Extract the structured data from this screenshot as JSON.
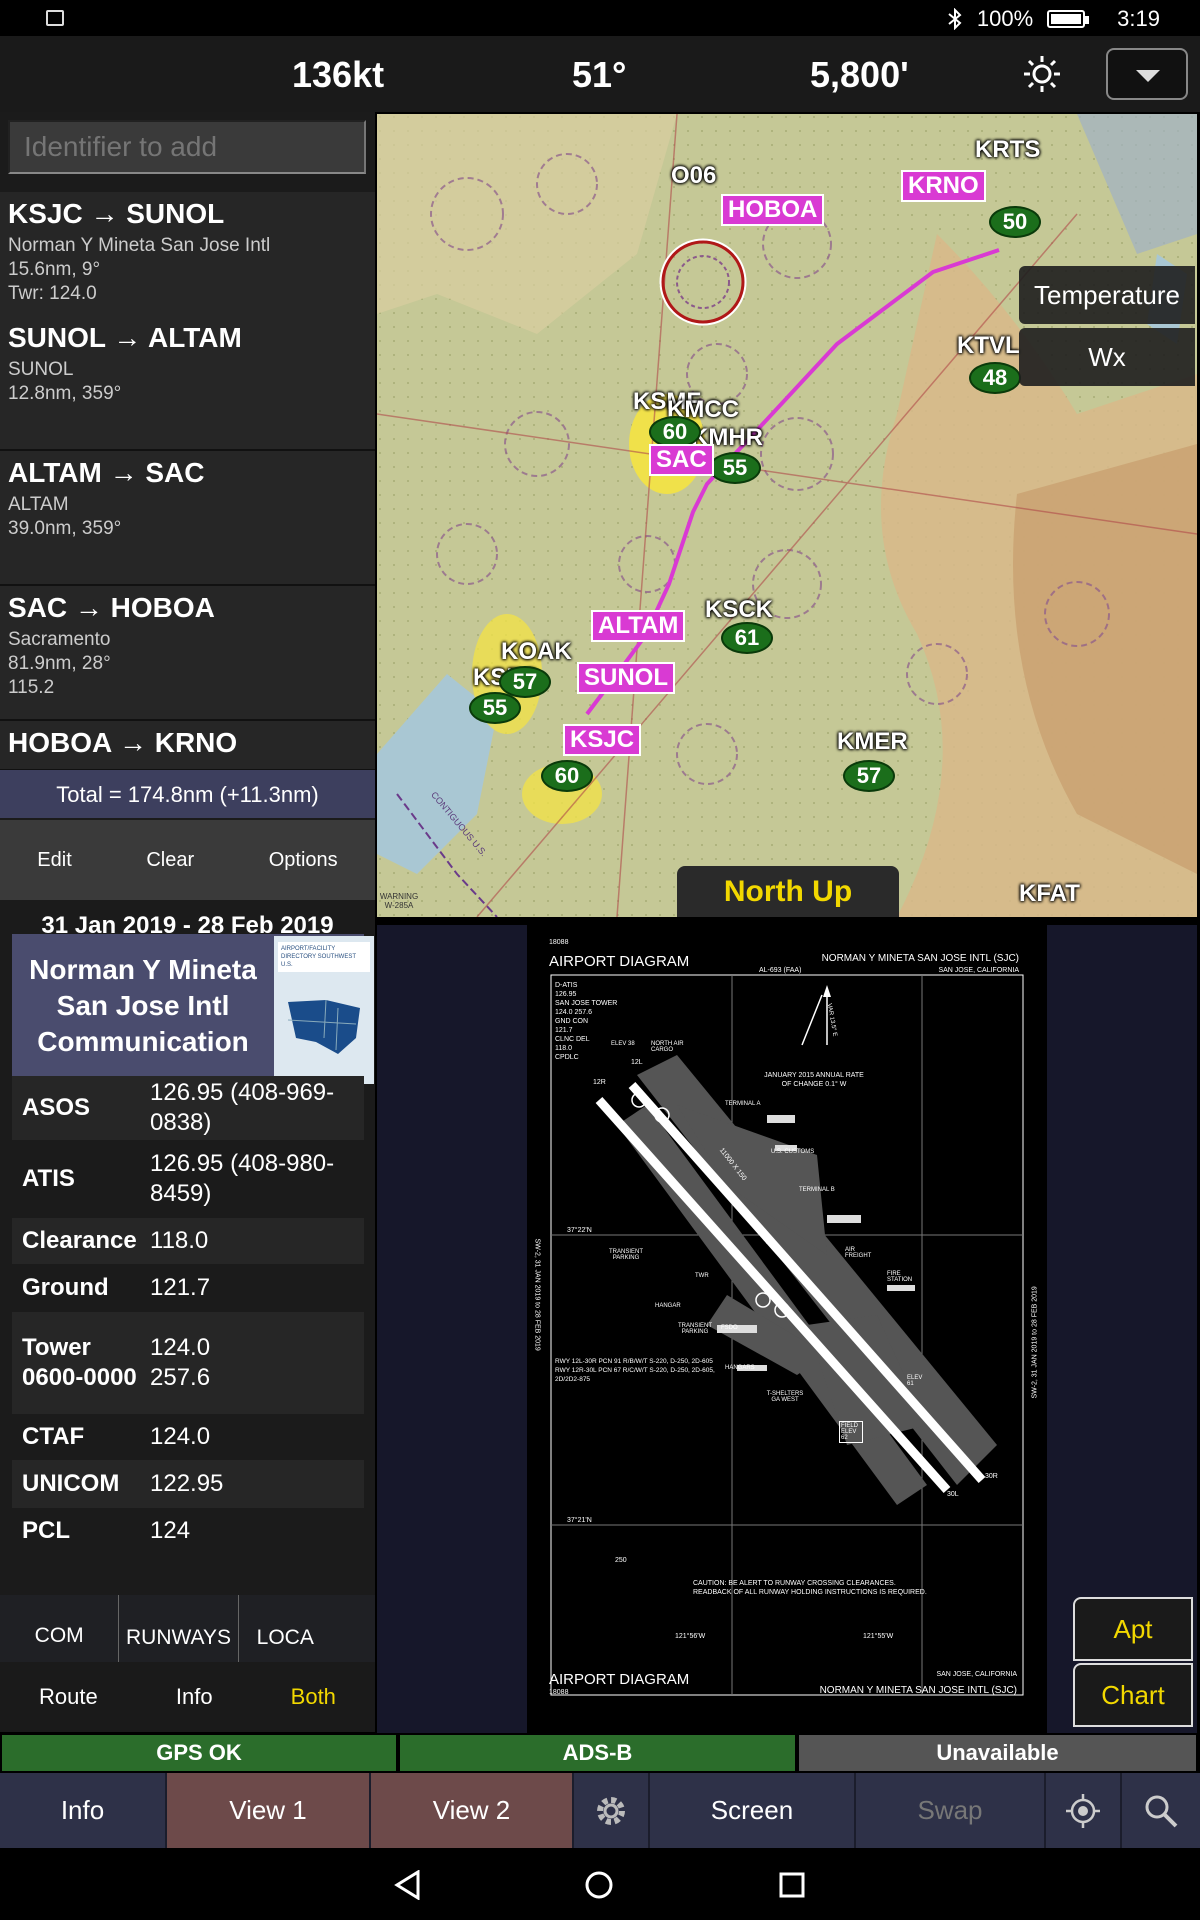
{
  "status": {
    "battery": "100%",
    "time": "3:19",
    "icons": [
      "image-icon",
      "bluetooth-icon",
      "battery-icon"
    ]
  },
  "topbar": {
    "speed": "136kt",
    "heading": "51°",
    "altitude": "5,800'",
    "icons": [
      "sun-icon",
      "chevron-down-icon"
    ]
  },
  "route": {
    "identifier_placeholder": "Identifier to add",
    "legs": [
      {
        "title": "KSJC → SUNOL",
        "line1": "Norman Y Mineta San Jose Intl",
        "line2": "15.6nm, 9°",
        "line3": "Twr: 124.0"
      },
      {
        "title": "SUNOL → ALTAM",
        "line1": "SUNOL",
        "line2": "12.8nm, 359°",
        "line3": ""
      },
      {
        "title": "ALTAM → SAC",
        "line1": "ALTAM",
        "line2": "39.0nm, 359°",
        "line3": ""
      },
      {
        "title": "SAC → HOBOA",
        "line1": "Sacramento",
        "line2": "81.9nm, 28°",
        "line3": "115.2"
      },
      {
        "title": "HOBOA → KRNO",
        "line1": "",
        "line2": "",
        "line3": ""
      }
    ],
    "total": "Total = 174.8nm (+11.3nm)",
    "actions": {
      "edit": "Edit",
      "clear": "Clear",
      "options": "Options"
    }
  },
  "afd": {
    "dates": "31 Jan 2019 - 28 Feb 2019",
    "title": "Norman Y Mineta San Jose Intl Communication",
    "cover_title": "AIRPORT/FACILITY DIRECTORY SOUTHWEST U.S.",
    "frequencies": [
      {
        "name": "ASOS",
        "value": "126.95 (408-969-0838)"
      },
      {
        "name": "ATIS",
        "value": "126.95 (408-980-8459)"
      },
      {
        "name": "Clearance",
        "value": "118.0"
      },
      {
        "name": "Ground",
        "value": "121.7"
      },
      {
        "name": "Tower 0600-0000",
        "value": "124.0 257.6"
      },
      {
        "name": "CTAF",
        "value": "124.0"
      },
      {
        "name": "UNICOM",
        "value": "122.95"
      },
      {
        "name": "PCL",
        "value": "124"
      }
    ]
  },
  "tabs": {
    "com": "COM",
    "runways": "RUNWAYS",
    "location": "LOCA"
  },
  "subtabs": {
    "route": "Route",
    "info": "Info",
    "both": "Both"
  },
  "map": {
    "orientation": "North Up",
    "layers": {
      "temperature": "Temperature",
      "wx": "Wx"
    },
    "labels": {
      "o06": "O06",
      "krts": "KRTS",
      "ktvl": "KTVL",
      "ksmf": "KSMF",
      "kmcc": "KMCC",
      "kmhr": "KMHR",
      "ksck": "KSCK",
      "koak": "KOAK",
      "ksfo": "KSFO",
      "kmer": "KMER",
      "kfat": "KFAT"
    },
    "waypoints": {
      "hoboa": "HOBOA",
      "krno": "KRNO",
      "sac": "SAC",
      "altam": "ALTAM",
      "sunol": "SUNOL",
      "ksjc": "KSJC"
    },
    "temps": {
      "krno": "50",
      "ktvl": "48",
      "ksmf": "60",
      "kmhr": "55",
      "ksck": "61",
      "koak": "57",
      "ksfo": "55",
      "ksjc": "60",
      "kmer": "57"
    },
    "small_text": {
      "contiguous": "CONTIGUOUS U.S.",
      "warning": "WARNING W-285A"
    }
  },
  "diagram": {
    "header_left": "AIRPORT DIAGRAM",
    "header_id": "18088",
    "header_right": "NORMAN Y MINETA SAN JOSE INTL (SJC)",
    "header_sub": "AL-693 (FAA)",
    "header_city": "SAN JOSE, CALIFORNIA",
    "freqs": [
      "D-ATIS",
      "126.95",
      "SAN JOSE TOWER",
      "124.0 257.6",
      "GND CON",
      "121.7",
      "CLNC DEL",
      "118.0",
      "CPDLC"
    ],
    "variation": "JANUARY 2015 ANNUAL RATE OF CHANGE 0.1° W",
    "var_label": "VAR 13.5° E",
    "labels": [
      "ELEV 38",
      "NORTH AIR CARGO",
      "TERMINAL A",
      "U.S. CUSTOMS",
      "TERMINAL B",
      "TRANSIENT PARKING",
      "AIR FREIGHT",
      "FIRE STATION",
      "HANGAR",
      "TRANSIENT PARKING",
      "FSDO",
      "HANGARS",
      "T-SHELTERS GA WEST",
      "FIELD ELEV 62",
      "ELEV 61",
      "TWR"
    ],
    "runway_dims": [
      "11000 X 150",
      "11000 X 150"
    ],
    "runway_ids": [
      "12L",
      "12R",
      "30L",
      "30R"
    ],
    "rwy_info": "RWY 12L-30R PCN 91 R/B/W/T S-220, D-250, 2D-605 RWY 12R-30L PCN 67 R/C/W/T S-220, D-250, 2D-605, 2D/2D2-875",
    "lat1": "37°22'N",
    "lat2": "37°21'N",
    "lon1": "121°56'W",
    "lon2": "121°55'W",
    "obstacle": "250",
    "caution": "CAUTION: BE ALERT TO RUNWAY CROSSING CLEARANCES. READBACK OF ALL RUNWAY HOLDING INSTRUCTIONS IS REQUIRED.",
    "side_left": "SW-2, 31 JAN 2019 to 28 FEB 2019",
    "side_right": "SW-2, 31 JAN 2019 to 28 FEB 2019",
    "footer_left": "AIRPORT DIAGRAM",
    "footer_id": "18088",
    "footer_right": "NORMAN Y MINETA SAN JOSE INTL (SJC)",
    "footer_city": "SAN JOSE, CALIFORNIA",
    "buttons": {
      "apt": "Apt",
      "chart": "Chart"
    }
  },
  "indicators": {
    "gps": "GPS OK",
    "adsb": "ADS-B",
    "unavailable": "Unavailable"
  },
  "nav": {
    "info": "Info",
    "view1": "View 1",
    "view2": "View 2",
    "screen": "Screen",
    "swap": "Swap",
    "icons": [
      "gear-icon",
      "location-icon",
      "magnifier-icon"
    ]
  },
  "colors": {
    "accent_blue": "#2fa0e0",
    "active_yellow": "#f2d800",
    "waypoint_magenta": "#d93ad3",
    "gps_green": "#2b6d2b",
    "view_brown": "#6d4a4a"
  }
}
